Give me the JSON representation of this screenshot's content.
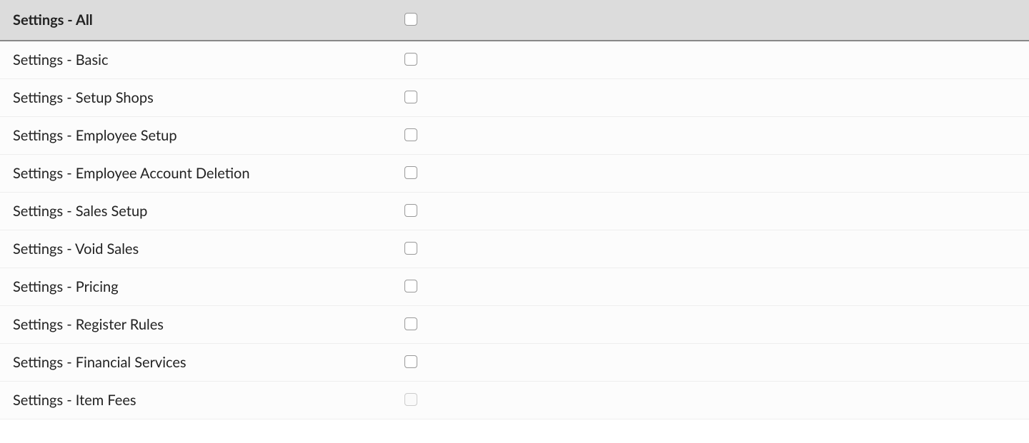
{
  "permissions": {
    "header": {
      "label": "Settings - All",
      "checked": false
    },
    "rows": [
      {
        "label": "Settings - Basic",
        "checked": false,
        "disabled": false
      },
      {
        "label": "Settings - Setup Shops",
        "checked": false,
        "disabled": false
      },
      {
        "label": "Settings - Employee Setup",
        "checked": false,
        "disabled": false
      },
      {
        "label": "Settings - Employee Account Deletion",
        "checked": false,
        "disabled": false
      },
      {
        "label": "Settings - Sales Setup",
        "checked": false,
        "disabled": false
      },
      {
        "label": "Settings - Void Sales",
        "checked": false,
        "disabled": false
      },
      {
        "label": "Settings - Pricing",
        "checked": false,
        "disabled": false
      },
      {
        "label": "Settings - Register Rules",
        "checked": false,
        "disabled": false
      },
      {
        "label": "Settings - Financial Services",
        "checked": false,
        "disabled": false
      },
      {
        "label": "Settings - Item Fees",
        "checked": false,
        "disabled": true
      }
    ]
  }
}
